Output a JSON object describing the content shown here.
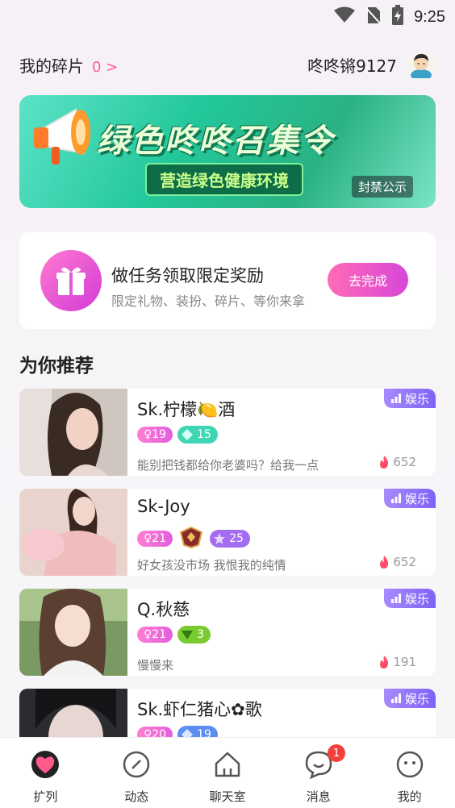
{
  "status_bar": {
    "time": "9:25"
  },
  "header": {
    "fragments_label": "我的碎片",
    "fragments_count": "0 >",
    "username": "咚咚锵9127"
  },
  "banner": {
    "title": "绿色咚咚召集令",
    "subtitle": "营造绿色健康环境",
    "notice": "封禁公示"
  },
  "task": {
    "title": "做任务领取限定奖励",
    "subtitle": "限定礼物、装扮、碎片、等你来拿",
    "button": "去完成"
  },
  "section_title": "为你推荐",
  "recommendations": [
    {
      "name": "Sk.柠檬🍋酒",
      "gender_age": "♀19",
      "level": "15",
      "level_color": "#3fd6b4",
      "desc": "能别把钱都给你老婆吗？给我一点",
      "heat": "652",
      "tag": "娱乐"
    },
    {
      "name": "Sk-Joy",
      "gender_age": "♀21",
      "level": "25",
      "level_color": "#a36cf1",
      "desc": "好女孩没市场 我恨我的纯情",
      "heat": "652",
      "tag": "娱乐"
    },
    {
      "name": "Q.秋慈",
      "gender_age": "♀21",
      "level": "3",
      "level_color": "#7acb2f",
      "desc": "慢慢来",
      "heat": "191",
      "tag": "娱乐"
    },
    {
      "name": "Sk.虾仁猪心✿歌",
      "gender_age": "♀20",
      "level": "19",
      "level_color": "#5b8ef0",
      "desc": "",
      "heat": "",
      "tag": "娱乐"
    }
  ],
  "bottom_nav": [
    {
      "label": "扩列",
      "icon": "heart-icon"
    },
    {
      "label": "动态",
      "icon": "compass-icon"
    },
    {
      "label": "聊天室",
      "icon": "house-icon"
    },
    {
      "label": "消息",
      "icon": "chat-bubble-icon",
      "badge": "1"
    },
    {
      "label": "我的",
      "icon": "face-icon"
    }
  ]
}
